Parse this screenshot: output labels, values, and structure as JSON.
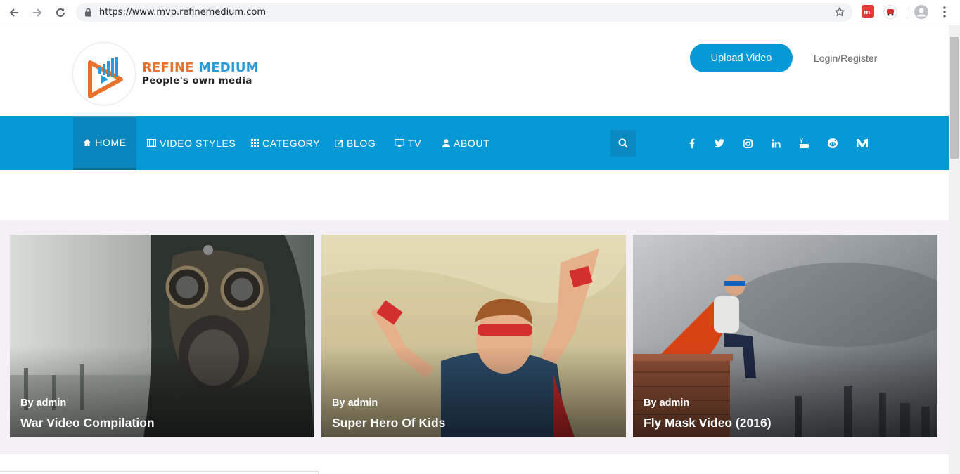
{
  "browser": {
    "url": "https://www.mvp.refinemedium.com"
  },
  "header": {
    "brand_part1": "REFINE",
    "brand_part2": "MEDIUM",
    "tagline": "People's own media",
    "upload_label": "Upload Video",
    "login_label": "Login/Register"
  },
  "nav": {
    "items": [
      {
        "label": "HOME",
        "icon": "home-icon"
      },
      {
        "label": "VIDEO STYLES",
        "icon": "film-icon"
      },
      {
        "label": "CATEGORY",
        "icon": "grid-icon"
      },
      {
        "label": "BLOG",
        "icon": "edit-icon"
      },
      {
        "label": "TV",
        "icon": "monitor-icon"
      },
      {
        "label": "ABOUT",
        "icon": "user-icon"
      }
    ],
    "social": [
      "facebook-icon",
      "twitter-icon",
      "instagram-icon",
      "linkedin-icon",
      "youtube-icon",
      "reddit-icon",
      "medium-icon"
    ]
  },
  "featured": [
    {
      "author": "By admin",
      "title": "War Video Compilation"
    },
    {
      "author": "By admin",
      "title": "Super Hero Of Kids"
    },
    {
      "author": "By admin",
      "title": "Fly Mask Video (2016)"
    }
  ],
  "colors": {
    "accent": "#0799d6",
    "brand_orange": "#e8712b",
    "brand_blue": "#2a9ad9"
  }
}
